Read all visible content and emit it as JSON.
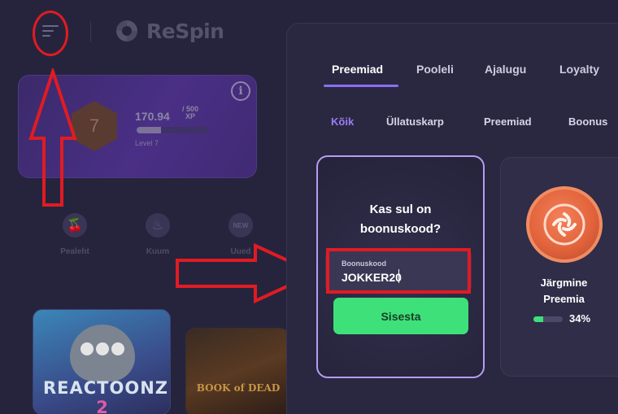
{
  "header": {
    "logo_text": "ReSpin",
    "menu_icon": "hamburger-menu-icon"
  },
  "xp_card": {
    "level_number": "7",
    "xp_current": "170.94",
    "xp_max": "500",
    "xp_unit": "XP",
    "xp_progress_fraction": 0.34,
    "level_label": "Level 7",
    "info_icon": "info-icon"
  },
  "quick_nav": [
    {
      "label": "Pealeht",
      "icon": "cherry-icon"
    },
    {
      "label": "Kuum",
      "icon": "flame-icon"
    },
    {
      "label": "Uued",
      "icon": "new-badge-icon",
      "badge": "NEW"
    }
  ],
  "games": [
    {
      "title": "REACTOONZ",
      "subtitle": "2"
    },
    {
      "title": "BOOK of DEAD"
    }
  ],
  "drawer": {
    "tabs": [
      {
        "label": "Preemiad",
        "active": true
      },
      {
        "label": "Pooleli",
        "active": false
      },
      {
        "label": "Ajalugu",
        "active": false
      },
      {
        "label": "Loyalty",
        "active": false
      }
    ],
    "subtabs": [
      {
        "label": "Kõik",
        "active": true
      },
      {
        "label": "Üllatuskarp",
        "active": false
      },
      {
        "label": "Preemiad",
        "active": false
      },
      {
        "label": "Boonus",
        "active": false
      }
    ],
    "bonus_card": {
      "question_line1": "Kas sul on",
      "question_line2": "boonuskood?",
      "field_label": "Boonuskood",
      "field_value": "JOKKER20",
      "submit_label": "Sisesta"
    },
    "reward_card": {
      "label_line1": "Järgmine",
      "label_line2": "Preemia",
      "progress_percent": "34%",
      "progress_fraction": 0.34,
      "accent_color": "#3ee07a",
      "coin_color": "#e2643c"
    }
  },
  "colors": {
    "background": "#23213a",
    "drawer": "#2a2841",
    "active_subtab": "#9c7cf6",
    "button_green": "#3ee07a",
    "annotation_red": "#e11b22"
  }
}
